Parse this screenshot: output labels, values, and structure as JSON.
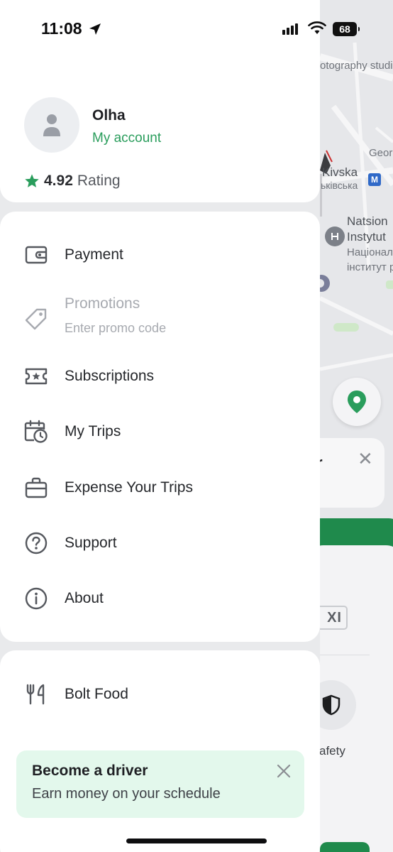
{
  "status_bar": {
    "time": "11:08",
    "battery": "68"
  },
  "profile": {
    "name": "Olha",
    "account_link": "My account",
    "rating_value": "4.92",
    "rating_label": "Rating"
  },
  "menu": {
    "items": [
      {
        "label": "Payment",
        "icon": "wallet-icon"
      },
      {
        "label": "Promotions",
        "subtitle": "Enter promo code",
        "icon": "tag-icon"
      },
      {
        "label": "Subscriptions",
        "icon": "ticket-star-icon"
      },
      {
        "label": "My Trips",
        "icon": "calendar-clock-icon"
      },
      {
        "label": "Expense Your Trips",
        "icon": "briefcase-icon"
      },
      {
        "label": "Support",
        "icon": "question-circle-icon"
      },
      {
        "label": "About",
        "icon": "info-circle-icon"
      }
    ]
  },
  "extra": {
    "food_label": "Bolt Food",
    "driver_banner": {
      "title": "Become a driver",
      "subtitle": "Earn money on your schedule"
    }
  },
  "background_map": {
    "labels": [
      "otography studi",
      "Georg",
      "Kivska",
      "ьківська",
      "Natsion",
      "Instytut",
      "Націонал",
      "інститут р"
    ],
    "metro_letter": "M",
    "taxi_tag": "XI",
    "safety_label": "afety",
    "card_text": "r"
  },
  "colors": {
    "accent_green": "#2a9d5c",
    "star_green": "#2a9d5c",
    "driver_banner_bg": "#e3f8ec",
    "brand_green": "#1f8a4c"
  }
}
